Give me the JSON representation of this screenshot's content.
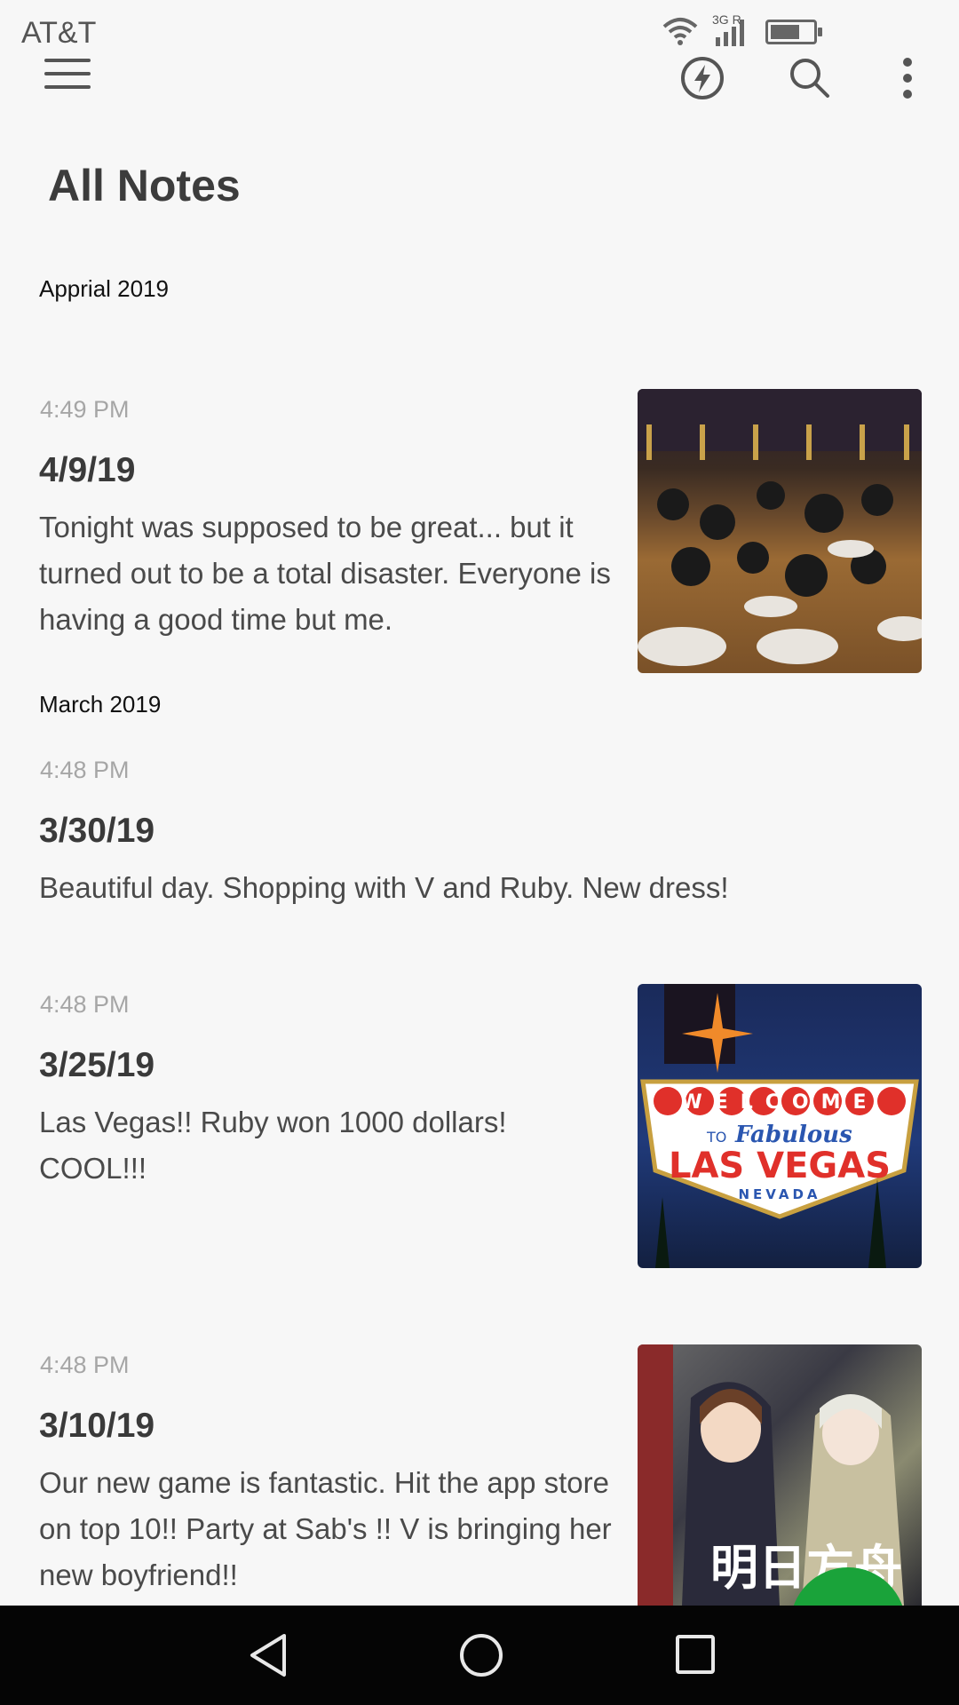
{
  "status_bar": {
    "carrier": "AT&T",
    "network_label": "3G R",
    "icons": [
      "wifi-icon",
      "signal-icon",
      "battery-icon"
    ]
  },
  "toolbar": {
    "icons": [
      "menu-icon",
      "bolt-icon",
      "search-icon",
      "more-icon"
    ]
  },
  "page": {
    "title": "All Notes"
  },
  "sections": [
    {
      "month": "Apprial 2019",
      "notes": [
        {
          "time": "4:49 PM",
          "title": "4/9/19",
          "body": "Tonight was supposed to be great... but it turned out to be a total disaster. Everyone is having a good time but me.",
          "thumbnail": "party-image"
        }
      ]
    },
    {
      "month": "March 2019",
      "notes": [
        {
          "time": "4:48 PM",
          "title": "3/30/19",
          "body": "Beautiful day. Shopping with V and Ruby. New dress!",
          "thumbnail": null
        },
        {
          "time": "4:48 PM",
          "title": "3/25/19",
          "body": "Las Vegas!! Ruby won 1000 dollars! COOL!!!",
          "thumbnail": "vegas-image",
          "thumbnail_text": {
            "welcome": "WELCOME",
            "to": "TO",
            "fabulous": "Fabulous",
            "city": "LAS VEGAS",
            "state": "NEVADA"
          }
        },
        {
          "time": "4:48 PM",
          "title": "3/10/19",
          "body": "Our new game is fantastic. Hit the app store on top 10!!  Party at Sab's !! V is bringing her new boyfriend!!",
          "thumbnail": "anime-image",
          "thumbnail_text": {
            "logo": "明日方舟"
          }
        }
      ]
    }
  ],
  "nav_bar": {
    "icons": [
      "nav-back-icon",
      "nav-home-icon",
      "nav-recents-icon"
    ]
  },
  "colors": {
    "background": "#f7f7f7",
    "fab": "#1aa33a",
    "nav_bar": "#050505",
    "time_text": "#a6a6a6"
  }
}
